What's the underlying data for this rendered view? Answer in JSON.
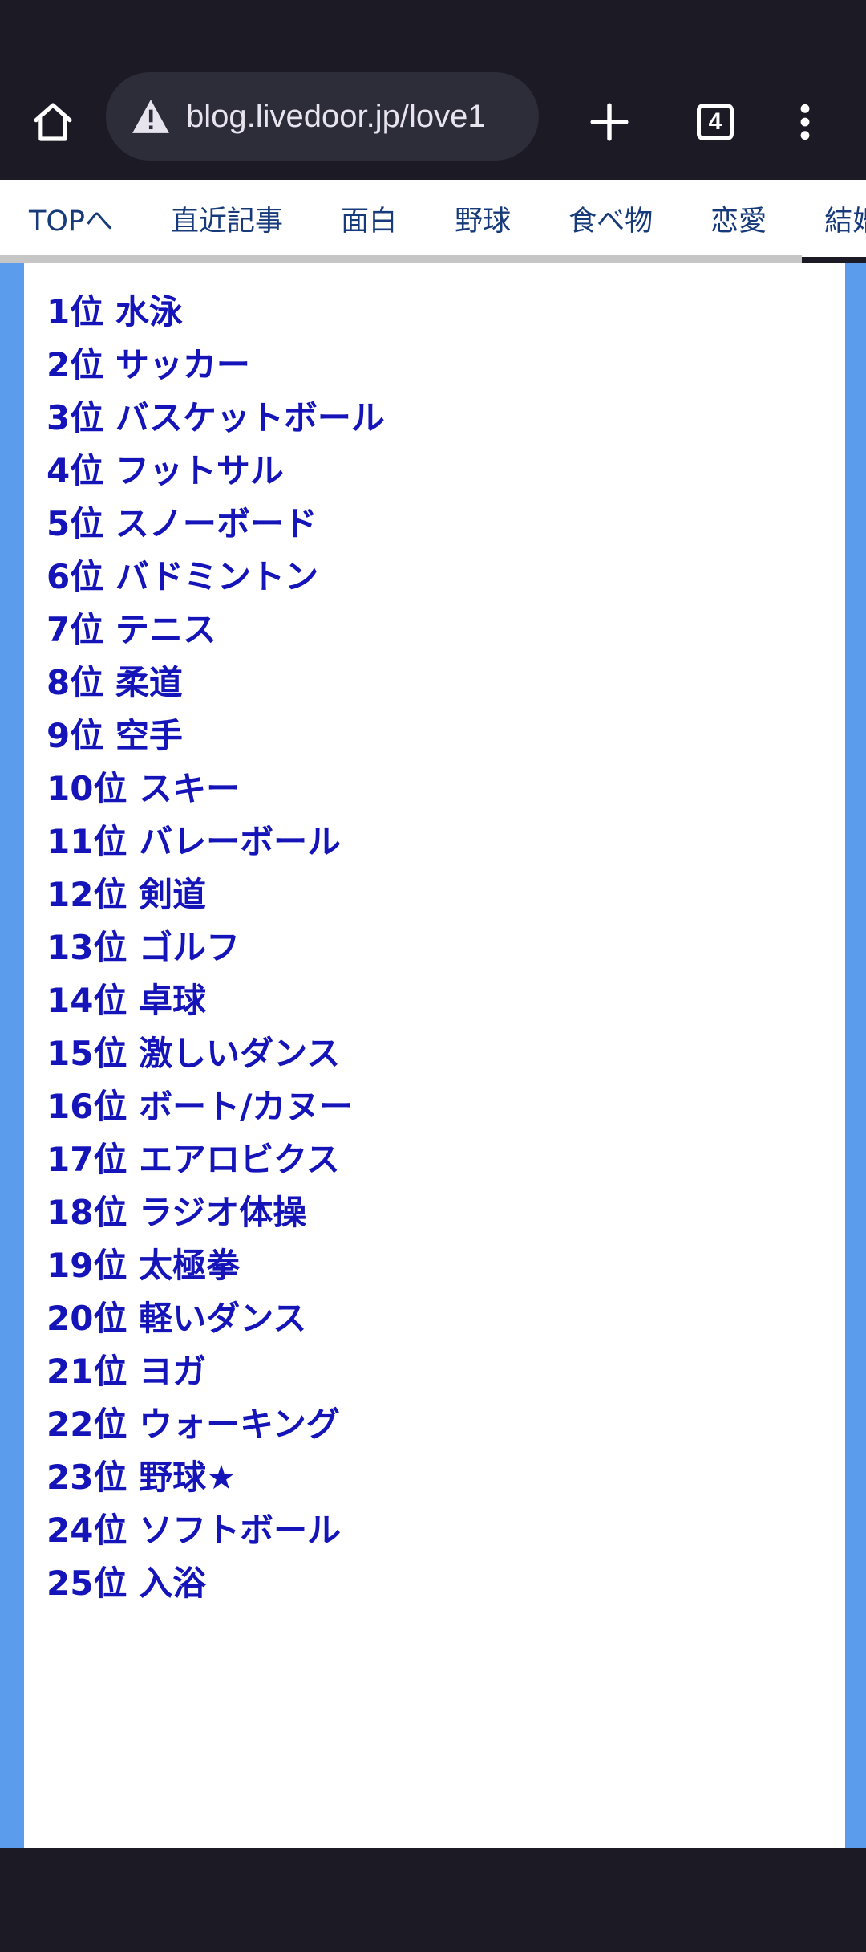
{
  "browser": {
    "url": "blog.livedoor.jp/love1",
    "tab_count": "4"
  },
  "site_nav": {
    "items": [
      "TOPへ",
      "直近記事",
      "面白",
      "野球",
      "食べ物",
      "恋愛",
      "結婚"
    ]
  },
  "ranking": {
    "items": [
      "1位 水泳",
      "2位 サッカー",
      "3位 バスケットボール",
      "4位 フットサル",
      "5位 スノーボード",
      "6位 バドミントン",
      "7位 テニス",
      "8位 柔道",
      "9位 空手",
      "10位 スキー",
      "11位 バレーボール",
      "12位 剣道",
      "13位 ゴルフ",
      "14位 卓球",
      "15位 激しいダンス",
      "16位 ボート/カヌー",
      "17位 エアロビクス",
      "18位 ラジオ体操",
      "19位 太極拳",
      "20位 軽いダンス",
      "21位 ヨガ",
      "22位 ウォーキング",
      "23位 野球★",
      "24位 ソフトボール",
      "25位 入浴"
    ]
  },
  "colors": {
    "chrome_bg": "#1c1b25",
    "url_bar_bg": "#2d2c39",
    "page_side": "#5b9cec",
    "ranking_text": "#1414b8",
    "nav_text": "#173a7a"
  },
  "icons": {
    "home": "home-icon",
    "warning": "warning-icon",
    "new_tab": "plus-icon",
    "menu": "more-vert-icon"
  }
}
